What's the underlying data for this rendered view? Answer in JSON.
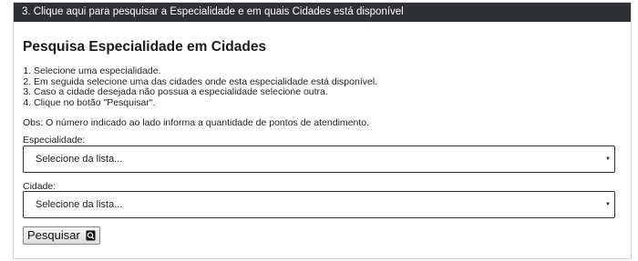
{
  "header": {
    "text": "3. Clique aqui para pesquisar a Especialidade e em quais Cidades está disponível"
  },
  "title": "Pesquisa Especialidade em Cidades",
  "steps": [
    "Selecione uma especialidade.",
    "Em seguida selecione uma das cidades onde esta especialidade está disponível.",
    "Caso a cidade desejada não possua a especialidade selecione outra.",
    "Clique no botão \"Pesquisar\"."
  ],
  "obs": "Obs: O número indicado ao lado informa a quantidade de pontos de atendimento.",
  "especialidade": {
    "label": "Especialidade:",
    "value": "Selecione da lista..."
  },
  "cidade": {
    "label": "Cidade:",
    "value": "Selecione da lista..."
  },
  "search_button": {
    "label": "Pesquisar",
    "icon": "search-icon"
  },
  "colors": {
    "header_bg": "#2e3033",
    "header_text": "#ffffff"
  }
}
